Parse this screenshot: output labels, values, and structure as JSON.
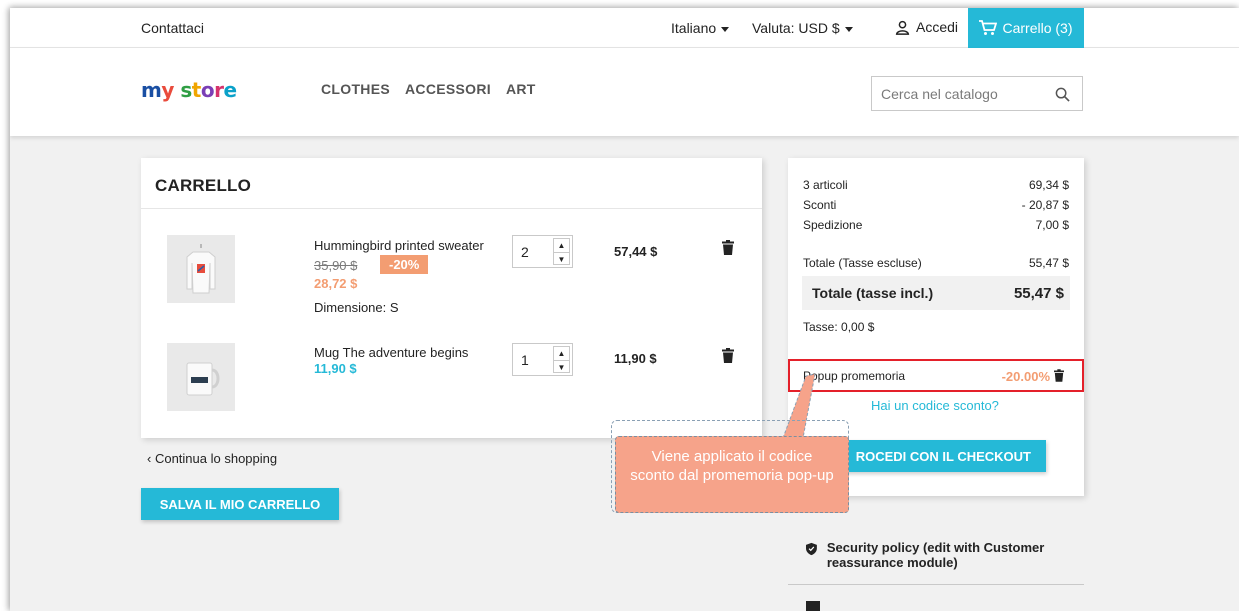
{
  "topbar": {
    "contact": "Contattaci",
    "language": "Italiano",
    "currency": "Valuta: USD $",
    "login": "Accedi",
    "cart": "Carrello (3)"
  },
  "header": {
    "logo": {
      "m": "m",
      "y": "y",
      "s1": "s",
      "s2": "t",
      "s3": "o",
      "s4": "r",
      "s5": "e"
    },
    "nav": [
      "CLOTHES",
      "ACCESSORI",
      "ART"
    ],
    "search_placeholder": "Cerca nel catalogo"
  },
  "cart": {
    "title": "CARRELLO",
    "items": [
      {
        "name": "Hummingbird printed sweater",
        "old_price": "35,90 $",
        "discount": "-20%",
        "price": "28,72 $",
        "attribute": "Dimensione: S",
        "qty": "2",
        "total": "57,44 $"
      },
      {
        "name": "Mug The adventure begins",
        "price": "11,90 $",
        "qty": "1",
        "total": "11,90 $"
      }
    ],
    "continue_shopping": "Continua lo shopping",
    "save_cart": "SALVA IL MIO CARRELLO"
  },
  "summary": {
    "items_label": "3 articoli",
    "items_value": "69,34 $",
    "discounts_label": "Sconti",
    "discounts_value": "- 20,87 $",
    "shipping_label": "Spedizione",
    "shipping_value": "7,00 $",
    "total_excl_label": "Totale (Tasse escluse)",
    "total_excl_value": "55,47 $",
    "total_incl_label": "Totale (tasse incl.)",
    "total_incl_value": "55,47 $",
    "taxes": "Tasse: 0,00 $",
    "voucher_name": "Popup promemoria",
    "voucher_value": "-20.00%",
    "have_code": "Hai un codice sconto?",
    "checkout": "ROCEDI CON IL CHECKOUT"
  },
  "reassurance": {
    "security": "Security policy (edit with Customer reassurance module)"
  },
  "callout": {
    "text": "Viene applicato il codice sconto dal promemoria pop-up"
  },
  "colors": {
    "accent": "#25b9d7",
    "discount": "#f39d72",
    "highlight_border": "#e4202a",
    "callout": "#f6a38a"
  }
}
